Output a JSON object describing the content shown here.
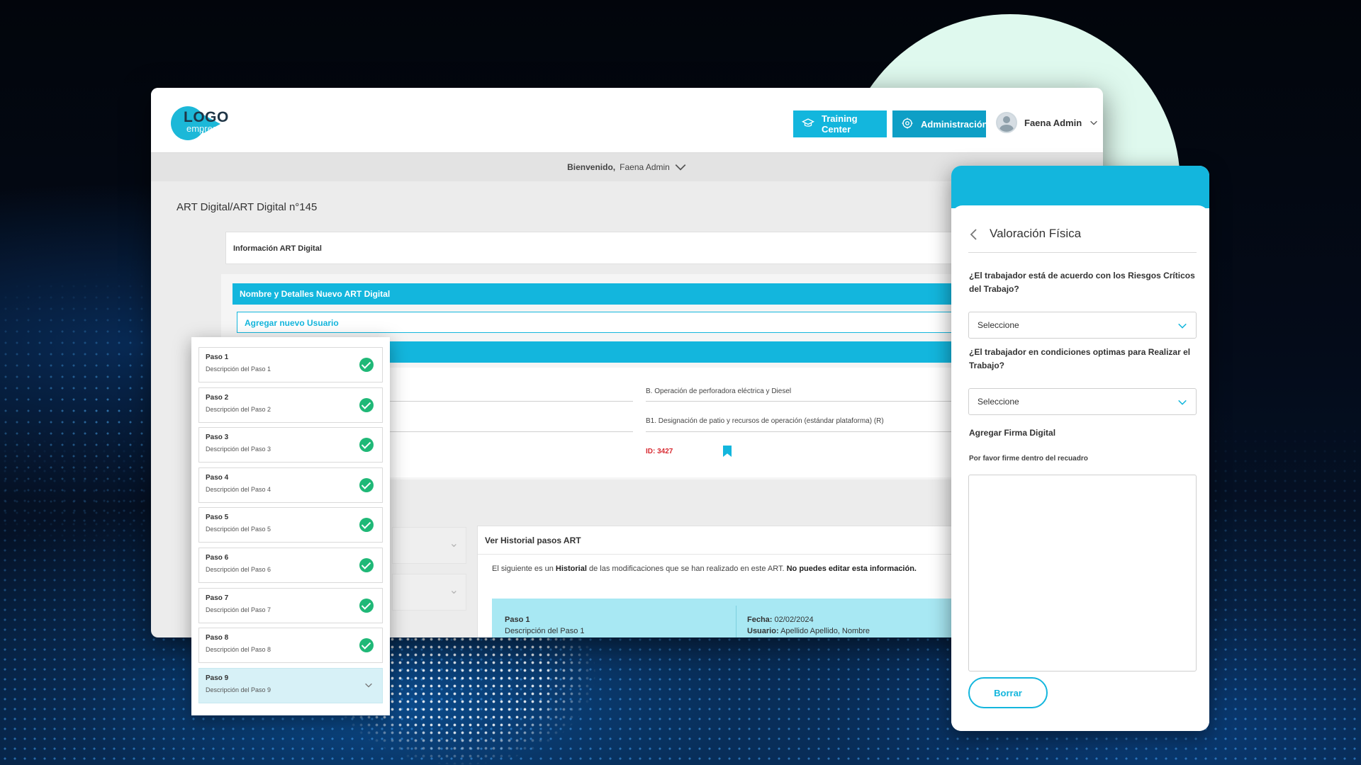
{
  "header": {
    "logo_text": "LOGO",
    "logo_sub": "empresa",
    "training_label": "Training Center",
    "admin_label": "Administración",
    "user_name": "Faena Admin"
  },
  "welcome": {
    "label": "Bienvenido,",
    "user": "Faena Admin"
  },
  "breadcrumb": "ART Digital/ART Digital n°145",
  "info_card": "Información ART Digital",
  "details": {
    "bar_title": "Nombre y Detalles Nuevo ART Digital",
    "add_user": "Agregar nuevo Usuario",
    "field_b": "B. Operación de perforadora eléctrica y Diesel",
    "field_b1": "B1. Designación de patio y recursos de operación (estándar plataforma) (R)",
    "id_label": "ID: 3427"
  },
  "history": {
    "title": "Ver Historial pasos ART",
    "desc_part1": "El siguiente es un ",
    "desc_bold1": "Historial",
    "desc_part2": " de las modificaciones que se han realizado en este ART. ",
    "desc_bold2": "No puedes editar esta información.",
    "row": {
      "step": "Paso 1",
      "step_desc": "Descripción del Paso 1",
      "date_label": "Fecha:",
      "date": "02/02/2024",
      "user_label": "Usuario:",
      "user": "Apellido Apellido, Nombre"
    }
  },
  "steps": [
    {
      "title": "Paso 1",
      "desc": "Descripción del Paso 1",
      "done": true
    },
    {
      "title": "Paso 2",
      "desc": "Descripción del Paso 2",
      "done": true
    },
    {
      "title": "Paso 3",
      "desc": "Descripción del Paso 3",
      "done": true
    },
    {
      "title": "Paso 4",
      "desc": "Descripción del Paso 4",
      "done": true
    },
    {
      "title": "Paso 5",
      "desc": "Descripción del Paso 5",
      "done": true
    },
    {
      "title": "Paso 6",
      "desc": "Descripción del Paso 6",
      "done": true
    },
    {
      "title": "Paso 7",
      "desc": "Descripción del Paso 7",
      "done": true
    },
    {
      "title": "Paso 8",
      "desc": "Descripción del Paso 8",
      "done": true
    },
    {
      "title": "Paso 9",
      "desc": "Descripción del Paso 9",
      "done": false
    }
  ],
  "panel": {
    "title": "Valoración Física",
    "q1": "¿El trabajador está de acuerdo con los Riesgos Críticos del Trabajo?",
    "q1_value": "Seleccione",
    "q2": "¿El trabajador en condiciones optimas para Realizar el Trabajo?",
    "q2_value": "Seleccione",
    "signature_label": "Agregar Firma Digital",
    "signature_hint": "Por favor firme dentro del recuadro",
    "clear_label": "Borrar"
  },
  "colors": {
    "accent": "#13b6dd",
    "success": "#1fb877",
    "danger": "#d7282f",
    "mint": "#dff9ee"
  }
}
